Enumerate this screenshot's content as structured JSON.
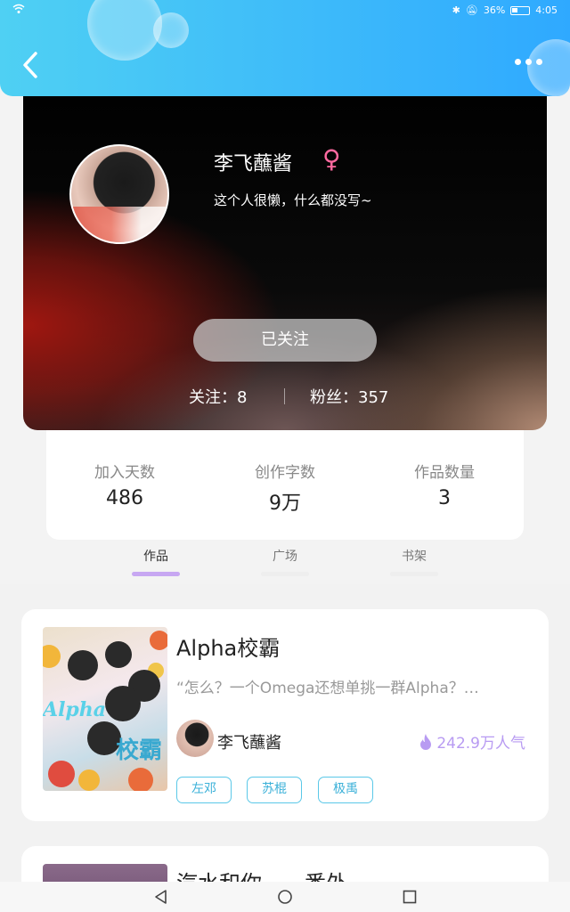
{
  "status_bar": {
    "battery": "36%",
    "time": "4:05"
  },
  "profile": {
    "name": "李飞蘸酱",
    "gender_symbol": "♀",
    "bio": "这个人很懒，什么都没写~",
    "follow_button": "已关注",
    "following": "关注：8",
    "followers": "粉丝：357"
  },
  "stats": [
    {
      "label": "加入天数",
      "value": "486"
    },
    {
      "label": "创作字数",
      "value": "9万"
    },
    {
      "label": "作品数量",
      "value": "3"
    }
  ],
  "tabs": [
    {
      "label": "作品",
      "active": true
    },
    {
      "label": "广场",
      "active": false
    },
    {
      "label": "书架",
      "active": false
    }
  ],
  "works": [
    {
      "title": "Alpha校霸",
      "excerpt": "“怎么？一个Omega还想单挑一群Alpha？…",
      "author": "李飞蘸酱",
      "popularity": "242.9万人气",
      "tags": [
        "左邓",
        "苏棍",
        "极禹"
      ],
      "cover_text_1": "Alpha",
      "cover_text_2": "校霸"
    },
    {
      "title": "汽水和你——番外"
    }
  ],
  "colors": {
    "header": "#2fa9ff",
    "accent_purple": "#b89bf2",
    "tag_blue": "#3ab0d8"
  }
}
